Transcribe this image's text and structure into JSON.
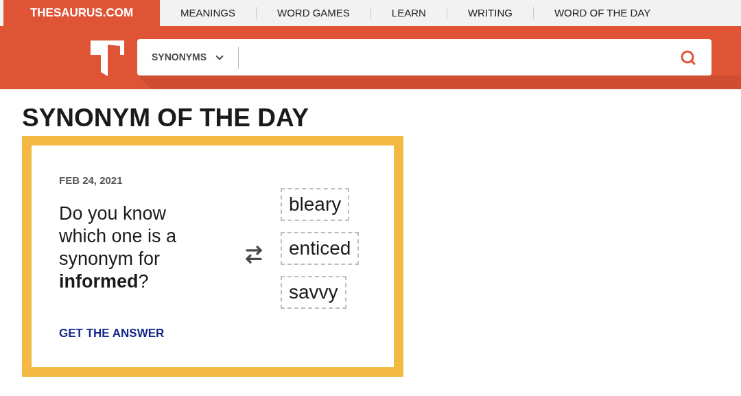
{
  "brand": "THESAURUS.COM",
  "nav": [
    {
      "label": "MEANINGS"
    },
    {
      "label": "WORD GAMES"
    },
    {
      "label": "LEARN"
    },
    {
      "label": "WRITING"
    },
    {
      "label": "WORD OF THE DAY"
    }
  ],
  "search": {
    "mode": "SYNONYMS"
  },
  "heading": "SYNONYM OF THE DAY",
  "card": {
    "date": "FEB 24, 2021",
    "question": "Do you know which one is a synonym for **informed**?",
    "link": "GET THE ANSWER",
    "options": [
      {
        "word": "bleary"
      },
      {
        "word": "enticed"
      },
      {
        "word": "savvy"
      }
    ]
  }
}
